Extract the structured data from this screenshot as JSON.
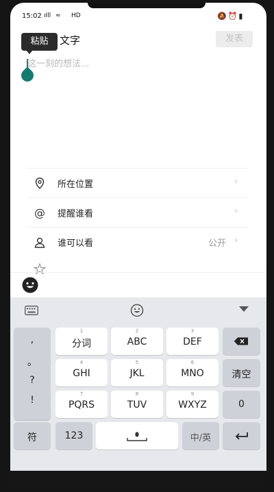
{
  "status": {
    "time": "15:02",
    "signal": "ıIll",
    "wifi": "≈",
    "hd": "HD",
    "right_icons": "🔕⏰▮"
  },
  "header": {
    "paste_tooltip": "粘贴",
    "title": "文字",
    "publish_label": "发表"
  },
  "editor": {
    "placeholder": "这一刻的想法..."
  },
  "options": [
    {
      "label": "所在位置",
      "value": ""
    },
    {
      "label": "提醒谁看",
      "value": ""
    },
    {
      "label": "谁可以看",
      "value": "公开"
    }
  ],
  "keyboard": {
    "punctuation": [
      ",",
      "。",
      "?",
      "!"
    ],
    "row1": [
      {
        "num": "1",
        "label": "分词"
      },
      {
        "num": "2",
        "label": "ABC"
      },
      {
        "num": "3",
        "label": "DEF"
      }
    ],
    "row2": [
      {
        "num": "4",
        "label": "GHI"
      },
      {
        "num": "5",
        "label": "JKL"
      },
      {
        "num": "6",
        "label": "MNO"
      }
    ],
    "row3": [
      {
        "num": "7",
        "label": "PQRS"
      },
      {
        "num": "8",
        "label": "TUV"
      },
      {
        "num": "9",
        "label": "WXYZ"
      }
    ],
    "clear_label": "清空",
    "zero_label": "0",
    "symbol_label": "符",
    "num_label": "123",
    "lang_label": "中/英"
  },
  "colors": {
    "accent": "#167a73",
    "publish_disabled": "#ececec"
  }
}
